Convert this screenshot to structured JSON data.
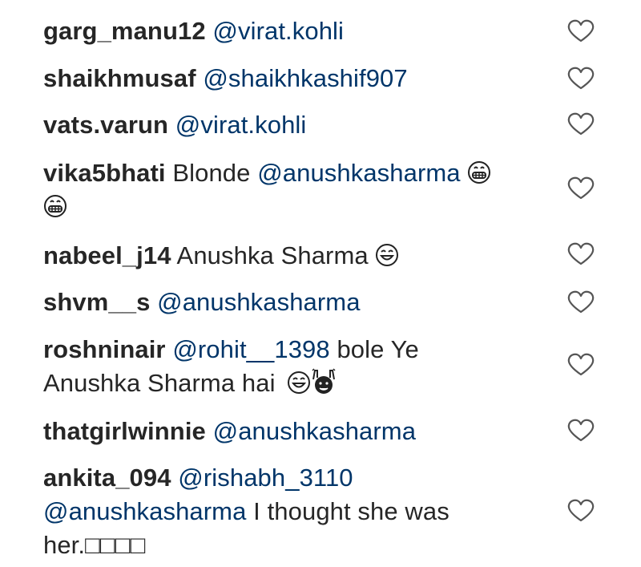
{
  "comments": [
    {
      "username": "garg_manu12",
      "line1": " ",
      "mention1": "@virat.kohli",
      "line1b": "",
      "line2": "",
      "emoji": "",
      "like_icon": "heart-outline-icon"
    },
    {
      "username": "shaikhmusaf",
      "line1": " ",
      "mention1": "@shaikhkashif907",
      "line1b": "",
      "line2": "",
      "emoji": "",
      "like_icon": "heart-outline-icon"
    },
    {
      "username": "vats.varun",
      "line1": " ",
      "mention1": "@virat.kohli",
      "line1b": "",
      "line2": "",
      "emoji": "",
      "like_icon": "heart-outline-icon"
    },
    {
      "username": "vika5bhati",
      "line1": " Blonde ",
      "mention1": "@anushkasharma",
      "line1b": "",
      "line2": "",
      "emoji": "grinning-emoji x2",
      "like_icon": "heart-outline-icon"
    },
    {
      "username": "nabeel_j14",
      "line1": " Anushka Sharma",
      "mention1": "",
      "line1b": "",
      "line2": "",
      "emoji": "laughing-emoji",
      "like_icon": "heart-outline-icon"
    },
    {
      "username": "shvm__s",
      "line1": " ",
      "mention1": "@anushkasharma",
      "line1b": "",
      "line2": "",
      "emoji": "",
      "like_icon": "heart-outline-icon"
    },
    {
      "username": "roshninair",
      "line1": " ",
      "mention1": "@rohit__1398",
      "line1b": " bole Ye",
      "line2": "Anushka Sharma hai",
      "emoji": "laughing-emoji raised-hands-emoji",
      "like_icon": "heart-outline-icon"
    },
    {
      "username": "thatgirlwinnie",
      "line1": " ",
      "mention1": "@anushkasharma",
      "line1b": "",
      "line2": "",
      "emoji": "",
      "like_icon": "heart-outline-icon"
    },
    {
      "username": "ankita_094",
      "line1": " ",
      "mention1": "@rishabh_3110",
      "line1b": "",
      "line2_mention": "@anushkasharma",
      "line2": " I thought she was",
      "line3": "her.□□□□",
      "emoji": "",
      "like_icon": "heart-outline-icon"
    }
  ]
}
